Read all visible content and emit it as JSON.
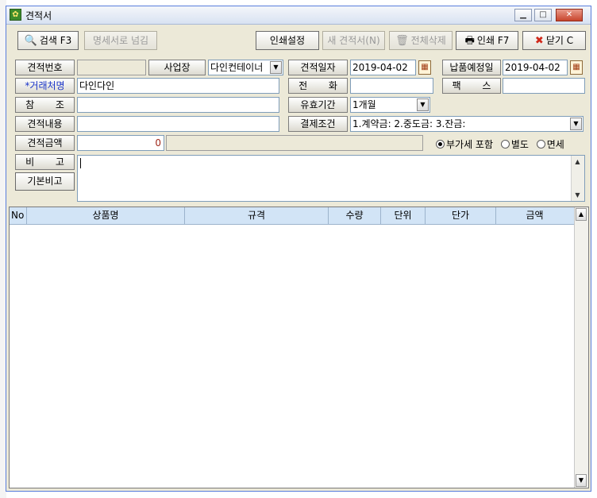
{
  "window": {
    "title": "견적서"
  },
  "titlebar_buttons": {
    "minimize": "▁",
    "maximize": "□",
    "close": "✕"
  },
  "toolbar": {
    "search": "검색 F3",
    "to_statement": "명세서로 넘김",
    "print_settings": "인쇄설정",
    "new_quote": "새 견적서(N)",
    "delete_all": "전체삭제",
    "print": "인쇄 F7",
    "close": "닫기 C"
  },
  "icons": {
    "search": "magnifier-icon",
    "delete": "trash-icon",
    "print": "printer-icon",
    "close": "red-x-icon",
    "calendar": "calendar-icon",
    "dropdown": "chevron-down-icon",
    "app": "app-icon"
  },
  "form": {
    "quote_no_label": "견적번호",
    "quote_no_value": "",
    "business_label": "사업장",
    "business_value": "다인컨테이너",
    "quote_date_label": "견적일자",
    "quote_date_value": "2019-04-02",
    "delivery_date_label": "납품예정일",
    "delivery_date_value": "2019-04-02",
    "client_label": "*거래처명",
    "client_value": "다인다인",
    "phone_label": "전       화",
    "phone_value": "",
    "fax_label": "팩       스",
    "fax_value": "",
    "ref_label": "참       조",
    "ref_value": "",
    "validity_label": "유효기간",
    "validity_value": "1개월",
    "content_label": "견적내용",
    "content_value": "",
    "payment_label": "결제조건",
    "payment_value": "1.계약금: 2.중도금: 3.잔금:",
    "amount_label": "견적금액",
    "amount_value": "0",
    "amount_text": "",
    "note_label": "비       고",
    "default_note_button": "기본비고",
    "note_value": "",
    "vat_options": [
      "부가세 포함",
      "별도",
      "면세"
    ],
    "vat_selected": "부가세 포함"
  },
  "grid": {
    "columns": [
      "No",
      "상품명",
      "규격",
      "수량",
      "단위",
      "단가",
      "금액"
    ],
    "rows": []
  },
  "colors": {
    "required_label": "#1a34c8",
    "grid_header": "#d2e4f6",
    "window_bg": "#ece9d8",
    "close_button": "#c8452c"
  }
}
